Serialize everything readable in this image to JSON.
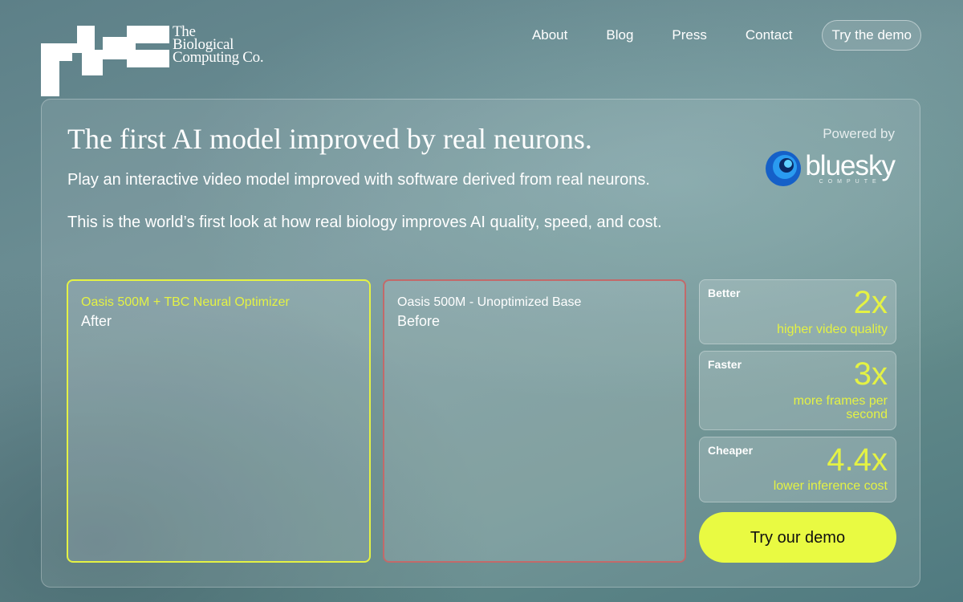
{
  "logo": {
    "line1": "The",
    "line2": "Biological",
    "line3": "Computing Co."
  },
  "nav": {
    "about": "About",
    "blog": "Blog",
    "press": "Press",
    "contact": "Contact",
    "demo": "Try the demo"
  },
  "hero": {
    "headline": "The first AI model improved by real neurons.",
    "sub1": "Play an interactive video model improved with software derived from real neurons.",
    "sub2": "This is the world’s first look at how real biology improves AI quality, speed, and cost.",
    "powered_by": "Powered by",
    "partner_name": "bluesky",
    "partner_sub": "COMPUTE"
  },
  "videos": {
    "after": {
      "label": "Oasis 500M + TBC Neural Optimizer",
      "state": "After"
    },
    "before": {
      "label": "Oasis 500M - Unoptimized Base",
      "state": "Before"
    }
  },
  "stats": [
    {
      "name": "Better",
      "value": "2x",
      "desc": "higher video quality"
    },
    {
      "name": "Faster",
      "value": "3x",
      "desc": "more frames per second"
    },
    {
      "name": "Cheaper",
      "value": "4.4x",
      "desc": "lower inference cost"
    }
  ],
  "cta": {
    "label": "Try our demo"
  },
  "colors": {
    "accent": "#e4f244",
    "button": "#e9fa42",
    "after_border": "#e4f244",
    "before_border": "#c26a6a"
  }
}
